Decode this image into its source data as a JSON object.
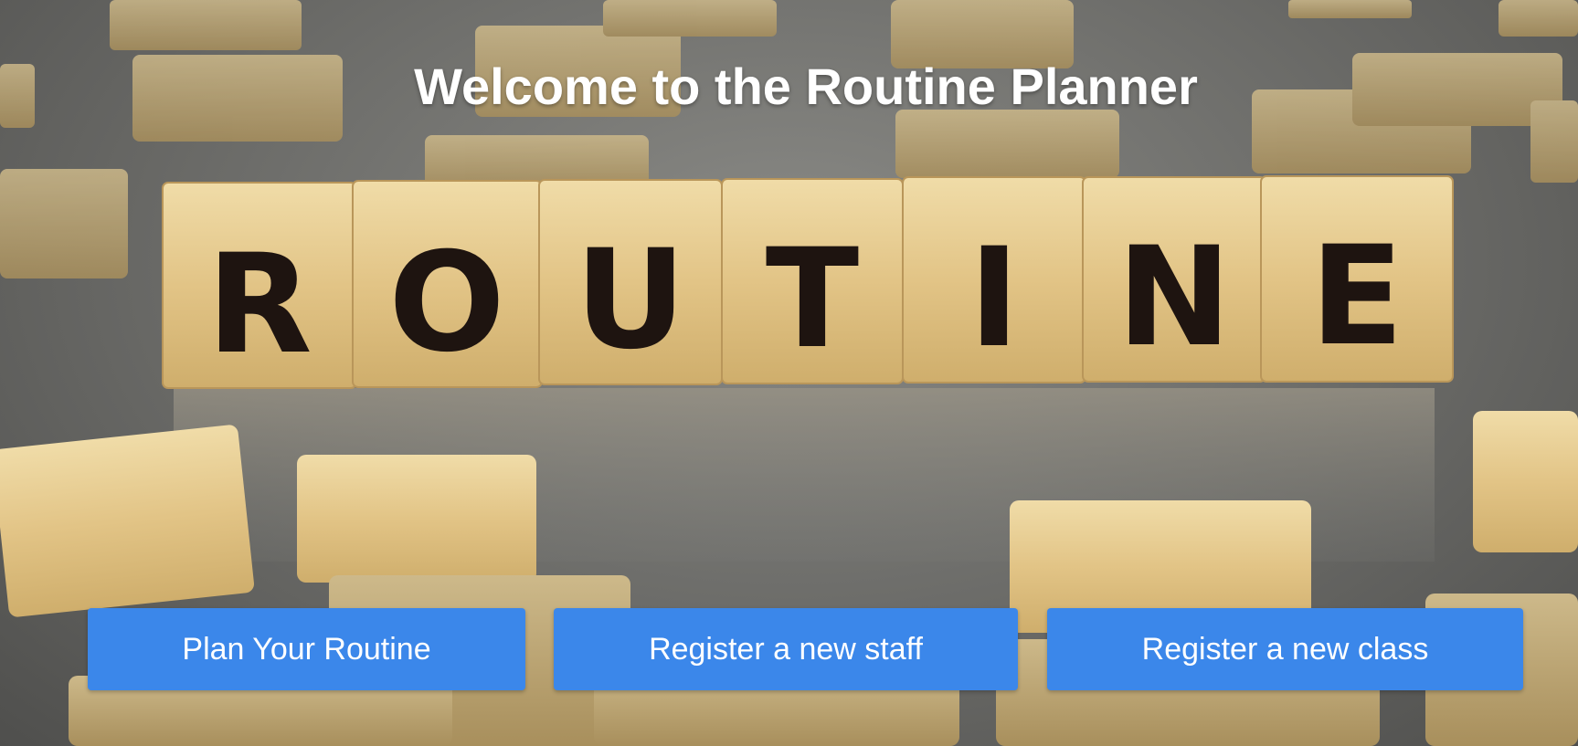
{
  "page": {
    "title": "Welcome to the Routine Planner"
  },
  "hero_image": {
    "tile_word": [
      "R",
      "O",
      "U",
      "T",
      "I",
      "N",
      "E"
    ]
  },
  "actions": {
    "plan_label": "Plan Your Routine",
    "staff_label": "Register a new staff",
    "class_label": "Register a new class"
  },
  "colors": {
    "button_bg": "#3b87ea",
    "button_text": "#ffffff",
    "title_text": "#ffffff"
  }
}
